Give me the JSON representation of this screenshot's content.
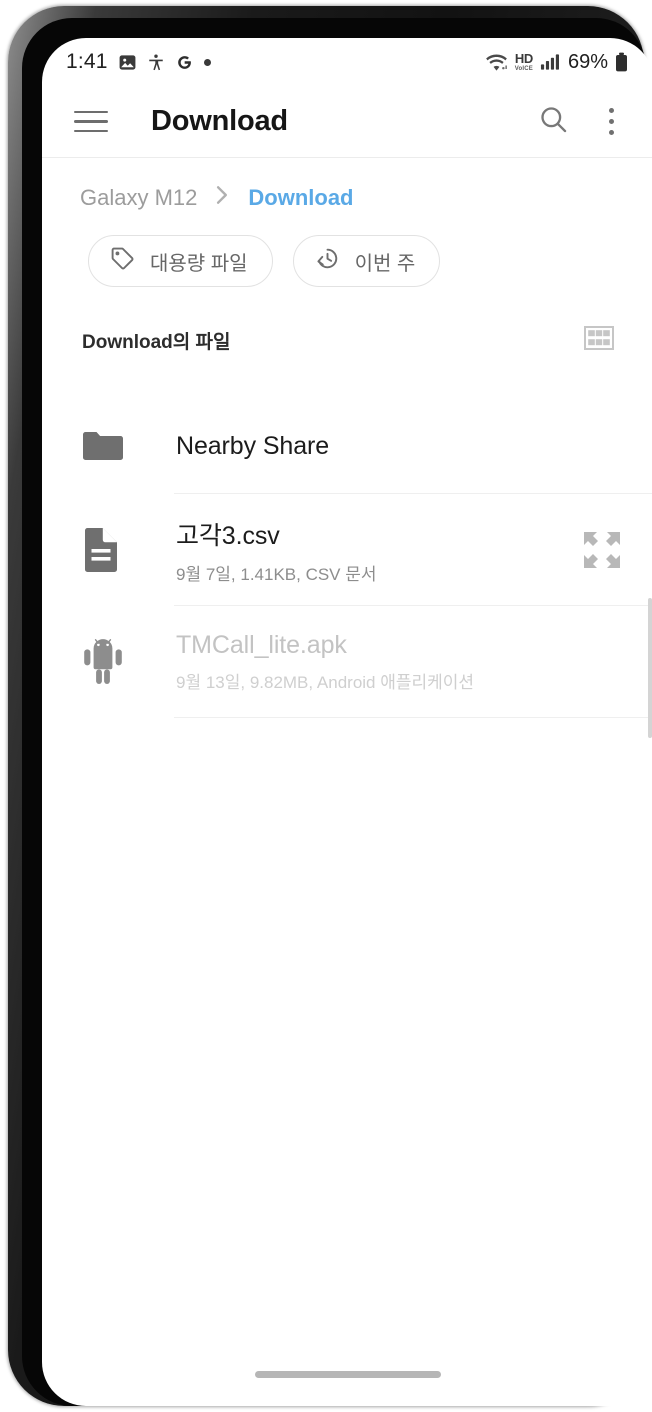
{
  "status_bar": {
    "time": "1:41",
    "left_icons": [
      "image-icon",
      "accessibility-icon",
      "google-g-icon",
      "dot-icon"
    ],
    "wifi_icon": "wifi-icon",
    "network_label": "HD",
    "network_sublabel": "VoICE",
    "signal_icon": "signal-bars-icon",
    "battery_percent": "69%",
    "battery_icon": "battery-icon"
  },
  "app_bar": {
    "menu_icon": "hamburger-menu-icon",
    "title": "Download",
    "search_icon": "search-icon",
    "overflow_icon": "more-vertical-icon"
  },
  "breadcrumb": {
    "root": "Galaxy M12",
    "separator": "›",
    "current": "Download",
    "current_color": "#5aa9e6"
  },
  "chips": [
    {
      "icon": "tag-icon",
      "label": "대용량 파일"
    },
    {
      "icon": "history-icon",
      "label": "이번 주"
    }
  ],
  "section": {
    "title": "Download의 파일",
    "view_toggle_icon": "grid-view-icon"
  },
  "files": [
    {
      "icon": "folder-icon",
      "name": "Nearby Share",
      "meta": "",
      "action_icon": "",
      "dimmed": false
    },
    {
      "icon": "document-icon",
      "name": "고각3.csv",
      "meta": "9월 7일, 1.41KB, CSV 문서",
      "action_icon": "expand-arrows-icon",
      "dimmed": false
    },
    {
      "icon": "android-icon",
      "name": "TMCall_lite.apk",
      "meta": "9월 13일, 9.82MB, Android 애플리케이션",
      "action_icon": "",
      "dimmed": true
    }
  ],
  "navigation": {
    "home_indicator": "home-gesture-bar"
  }
}
